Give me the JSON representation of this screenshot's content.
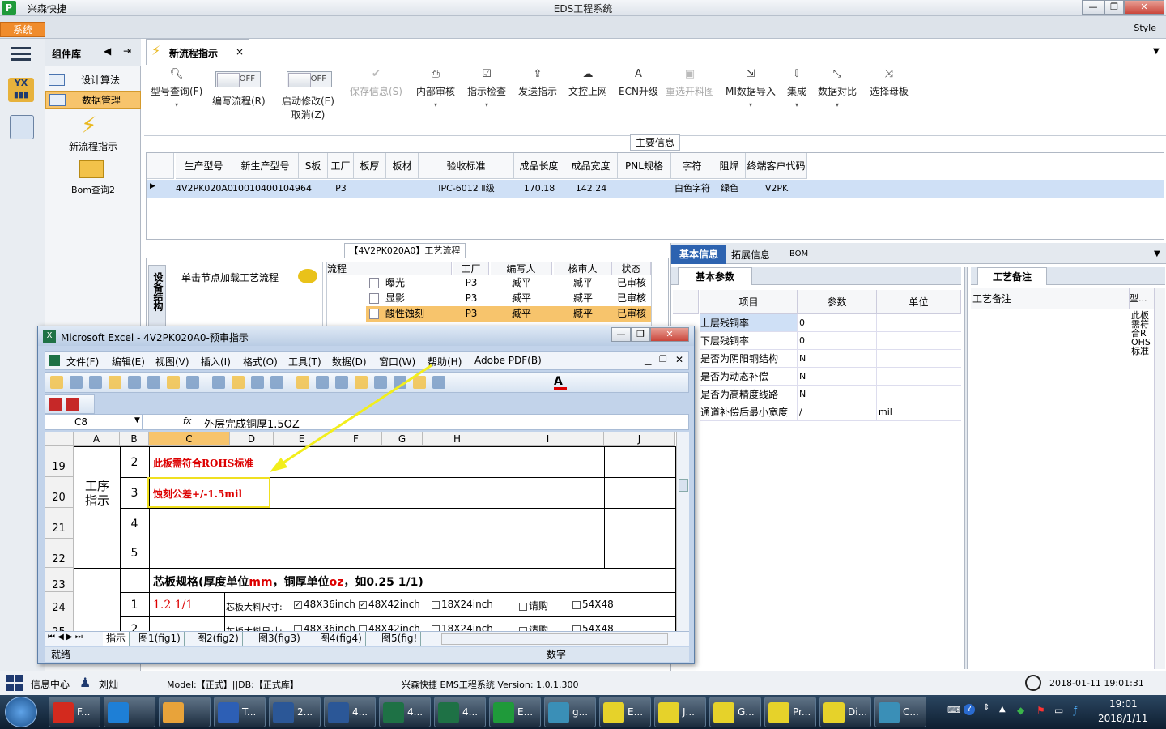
{
  "app": {
    "name": "兴森快捷",
    "window_title": "EDS工程系统",
    "system_tab": "系统",
    "style_label": "Style"
  },
  "window_buttons": {
    "minimize": "—",
    "restore": "❐",
    "close": "✕"
  },
  "sidebar": {
    "header": "组件库",
    "items": [
      {
        "label": "设计算法"
      },
      {
        "label": "数据管理"
      }
    ],
    "tools": [
      {
        "label": "新流程指示"
      },
      {
        "label": "Bom查询2"
      }
    ]
  },
  "doc_tab": {
    "label": "新流程指示",
    "close": "×"
  },
  "ribbon": {
    "model_query": "型号查询(F)",
    "edit_flow": "编写流程(R)",
    "edit_flow_toggle": "OFF",
    "enable_modify": "启动修改(E)",
    "enable_modify_sub": "取消(Z)",
    "enable_modify_toggle": "OFF",
    "save_info": "保存信息(S)",
    "internal_review": "内部审核",
    "instruction_check": "指示检查",
    "send_instruction": "发送指示",
    "doc_upload": "文控上网",
    "ecn_upgrade": "ECN升级",
    "reselect_material": "重选开料图",
    "mi_import": "MI数据导入",
    "integrate": "集成",
    "data_compare": "数据对比",
    "select_mother": "选择母板"
  },
  "main_info": {
    "title": "主要信息",
    "columns": [
      "生产型号",
      "新生产型号",
      "S板",
      "工厂",
      "板厚",
      "板材",
      "验收标准",
      "成品长度",
      "成品宽度",
      "PNL规格",
      "字符",
      "阻焊",
      "终端客户代码"
    ],
    "row": [
      "4V2PK020A0",
      "10010400104964",
      "",
      "P3",
      "",
      "",
      "IPC-6012 Ⅱ级",
      "170.18",
      "142.24",
      "",
      "白色字符",
      "绿色",
      "V2PK"
    ]
  },
  "process": {
    "title": "【4V2PK020A0】工艺流程",
    "device_tab": "设备结构",
    "node_hint": "单击节点加载工艺流程",
    "columns": [
      "流程",
      "工厂",
      "编写人",
      "核审人",
      "状态"
    ],
    "rows": [
      [
        "曝光",
        "P3",
        "臧平",
        "臧平",
        "已审核"
      ],
      [
        "显影",
        "P3",
        "臧平",
        "臧平",
        "已审核"
      ],
      [
        "酸性蚀刻",
        "P3",
        "臧平",
        "臧平",
        "已审核"
      ]
    ]
  },
  "right_panel": {
    "tabs": [
      "基本信息",
      "拓展信息",
      "BOM"
    ],
    "basic_params_title": "基本参数",
    "param_columns": [
      "项目",
      "参数",
      "单位"
    ],
    "params": [
      [
        "上层残铜率",
        "0",
        ""
      ],
      [
        "下层残铜率",
        "0",
        ""
      ],
      [
        "是否为阴阳铜结构",
        "N",
        ""
      ],
      [
        "是否为动态补偿",
        "N",
        ""
      ],
      [
        "是否为高精度线路",
        "N",
        ""
      ],
      [
        "通道补偿后最小宽度",
        "/",
        "mil"
      ]
    ],
    "remarks_title": "工艺备注",
    "remarks_col": "工艺备注",
    "type_col": "型...",
    "type_text": "此板需符合ROHS标准"
  },
  "excel": {
    "title": "Microsoft Excel - 4V2PK020A0-预审指示",
    "menus": [
      "文件(F)",
      "编辑(E)",
      "视图(V)",
      "插入(I)",
      "格式(O)",
      "工具(T)",
      "数据(D)",
      "窗口(W)",
      "帮助(H)",
      "Adobe PDF(B)"
    ],
    "name_box": "C8",
    "fx": "fx",
    "formula": "外层完成铜厚1.5OZ",
    "columns": [
      "A",
      "B",
      "C",
      "D",
      "E",
      "F",
      "G",
      "H",
      "I",
      "J"
    ],
    "rows": [
      "19",
      "20",
      "21",
      "22",
      "23",
      "24",
      "25"
    ],
    "section_label": "工序指示",
    "row_nums": [
      "2",
      "3",
      "4",
      "5",
      "",
      "1",
      "2"
    ],
    "cell_c19": "此板需符合ROHS标准",
    "cell_c20": "蚀刻公差+/-1.5mil",
    "row23": "芯板规格(厚度单位mm，铜厚单位oz，如0.25 1/1)",
    "row23_parts": {
      "a": "芯板规格(厚度单位",
      "b": "mm",
      "c": "，铜厚单位",
      "d": "oz",
      "e": "，如0.25 1/1)"
    },
    "cell_c24": "1.2 1/1",
    "size_label": "芯板大料尺寸:",
    "size_options": [
      "48X36inch",
      "48X42inch",
      "18X24inch",
      "请购",
      "54X48"
    ],
    "row24_checked": [
      true,
      true,
      false,
      false,
      false
    ],
    "row25_checked": [
      false,
      false,
      false,
      false,
      false
    ],
    "sheets": [
      "指示",
      "图1(fig1)",
      "图2(fig2)",
      "图3(fig3)",
      "图4(fig4)",
      "图5(fig!"
    ],
    "status_ready": "就绪",
    "status_num": "数字"
  },
  "statusbar": {
    "info_center": "信息中心",
    "user": "刘灿",
    "model": "Model:【正式】||DB:【正式库】",
    "system": "兴森快捷 EMS工程系统  Version: 1.0.1.300",
    "datetime": "2018-01-11 19:01:31"
  },
  "taskbar": {
    "items": [
      {
        "label": "F...",
        "color": "#d32a1e"
      },
      {
        "label": "",
        "color": "#1e7fd6"
      },
      {
        "label": "",
        "color": "#e8a33a"
      },
      {
        "label": "T...",
        "color": "#2d5fb5"
      },
      {
        "label": "2...",
        "color": "#2b5797"
      },
      {
        "label": "4...",
        "color": "#2b5797"
      },
      {
        "label": "4...",
        "color": "#1e7145"
      },
      {
        "label": "4...",
        "color": "#1e7145"
      },
      {
        "label": "E...",
        "color": "#1f9a3a"
      },
      {
        "label": "g...",
        "color": "#3a8fb7"
      },
      {
        "label": "E...",
        "color": "#e6d22a"
      },
      {
        "label": "J...",
        "color": "#e6d22a"
      },
      {
        "label": "G...",
        "color": "#e6d22a"
      },
      {
        "label": "Pr...",
        "color": "#e6d22a"
      },
      {
        "label": "Di...",
        "color": "#e6d22a"
      },
      {
        "label": "C...",
        "color": "#3a8fb7"
      }
    ],
    "time": "19:01",
    "date": "2018/1/11"
  }
}
